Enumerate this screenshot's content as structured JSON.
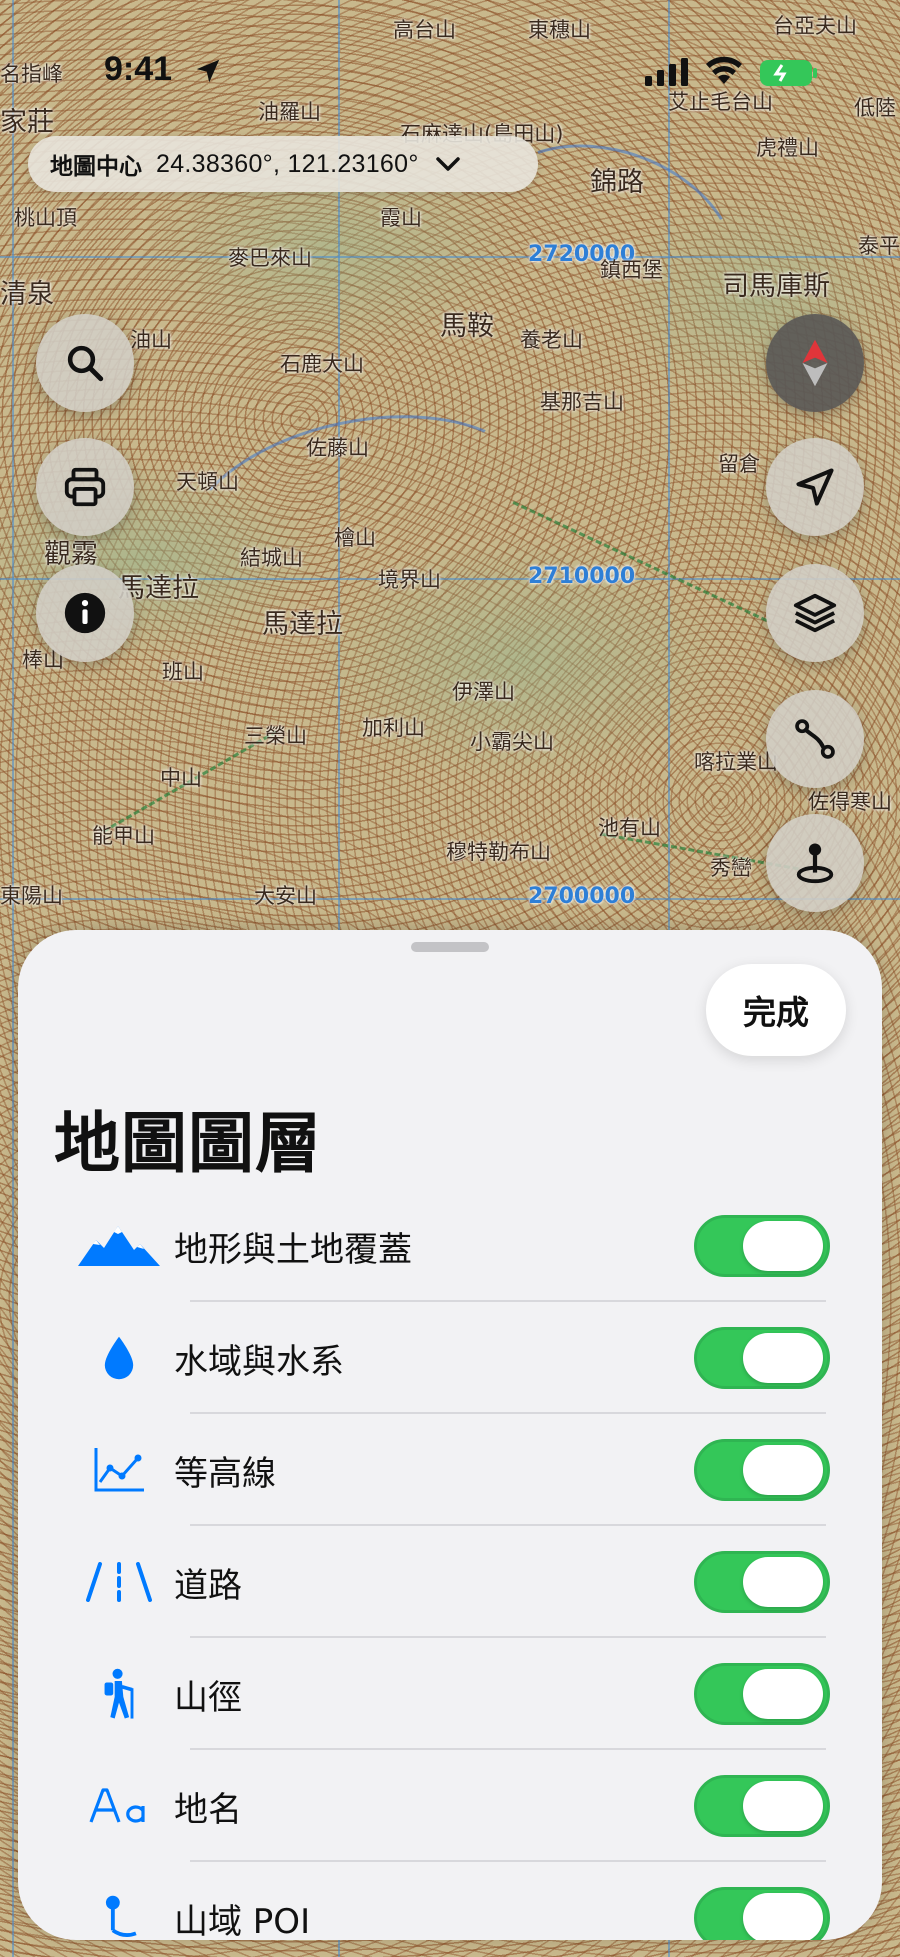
{
  "status_bar": {
    "time": "9:41"
  },
  "map": {
    "center_label": "地圖中心",
    "center_coords": "24.38360°, 121.23160°",
    "grid_labels": [
      "2720000",
      "2710000",
      "2700000"
    ],
    "places": [
      "名指峰",
      "高台山",
      "東穗山",
      "台亞夫山",
      "油羅山",
      "家莊",
      "艾止毛台山",
      "低陸",
      "石麻達山(島田山)",
      "錦路",
      "虎禮山",
      "桃山頂",
      "霞山",
      "泰平",
      "麥巴來山",
      "司馬庫斯",
      "清泉",
      "鎮西堡",
      "馬鞍",
      "養老山",
      "油山",
      "石鹿大山",
      "基那吉山",
      "佐藤山",
      "留倉",
      "天頓山",
      "觀霧",
      "結城山",
      "檜山",
      "馬達拉",
      "境界山",
      "馬達拉",
      "棒山",
      "班山",
      "伊澤山",
      "三榮山",
      "加利山",
      "小霸尖山",
      "喀拉業山",
      "中山",
      "佐得寒山",
      "能甲山",
      "池有山",
      "穆特勒布山",
      "秀巒",
      "東陽山",
      "大安山"
    ]
  },
  "sheet": {
    "done_label": "完成",
    "title": "地圖圖層",
    "layers": [
      {
        "label": "地形與土地覆蓋",
        "icon": "mountain-icon",
        "enabled": true
      },
      {
        "label": "水域與水系",
        "icon": "water-drop-icon",
        "enabled": true
      },
      {
        "label": "等高線",
        "icon": "contour-chart-icon",
        "enabled": true
      },
      {
        "label": "道路",
        "icon": "road-icon",
        "enabled": true
      },
      {
        "label": "山徑",
        "icon": "hiker-icon",
        "enabled": true
      },
      {
        "label": "地名",
        "icon": "text-aa-icon",
        "enabled": true
      },
      {
        "label": "山域 POI",
        "icon": "poi-pin-icon",
        "enabled": true
      }
    ]
  },
  "colors": {
    "accent": "#007aff",
    "toggle_on": "#34c759",
    "grid": "#2e7fd6"
  }
}
